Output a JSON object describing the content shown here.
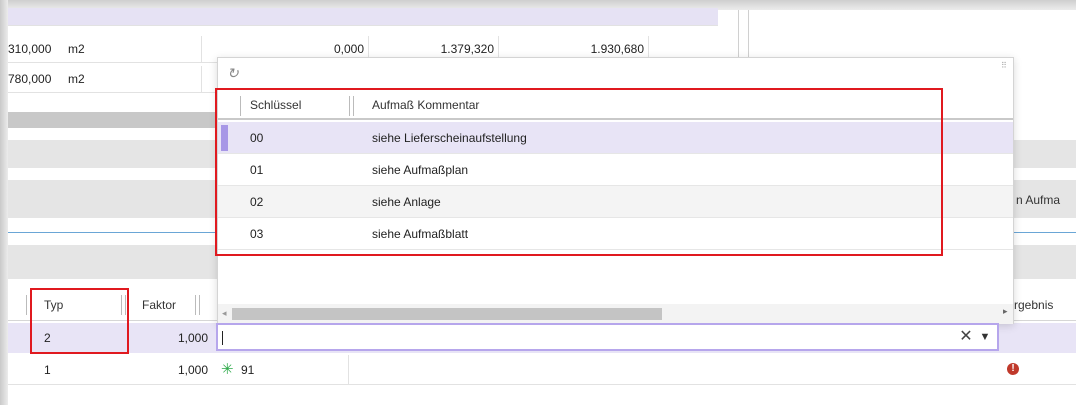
{
  "top_rows": [
    {
      "qty": "310,000",
      "unit": "m2",
      "v1": "0,000",
      "v2": "1.379,320",
      "v3": "1.930,680"
    },
    {
      "qty": "780,000",
      "unit": "m2",
      "v1": "",
      "v2": "",
      "v3": ""
    }
  ],
  "mid_header": {
    "partial_label": "n  Aufma"
  },
  "popup": {
    "refresh_icon": "refresh-icon",
    "columns": {
      "key": "Schlüssel",
      "comment": "Aufmaß Kommentar"
    },
    "rows": [
      {
        "key": "00",
        "comment": "siehe Lieferscheinaufstellung"
      },
      {
        "key": "01",
        "comment": "siehe Aufmaßplan"
      },
      {
        "key": "02",
        "comment": "siehe Anlage"
      },
      {
        "key": "03",
        "comment": "siehe Aufmaßblatt"
      }
    ]
  },
  "bottom_grid": {
    "columns": {
      "typ": "Typ",
      "faktor": "Faktor",
      "ergebnis": "rgebnis"
    },
    "rows": [
      {
        "typ": "2",
        "faktor": "1,000",
        "value": ""
      },
      {
        "typ": "1",
        "faktor": "1,000",
        "value": "91",
        "status_icon": "asterisk-icon"
      }
    ]
  },
  "input": {
    "value": "",
    "clear_label": "✕",
    "dropdown_icon": "caret-down-icon"
  },
  "colors": {
    "selection": "#e8e4f6",
    "highlight": "#e0191f",
    "focus": "#b6a6ec",
    "error": "#c0392b",
    "asterisk": "#2eaa4a"
  }
}
